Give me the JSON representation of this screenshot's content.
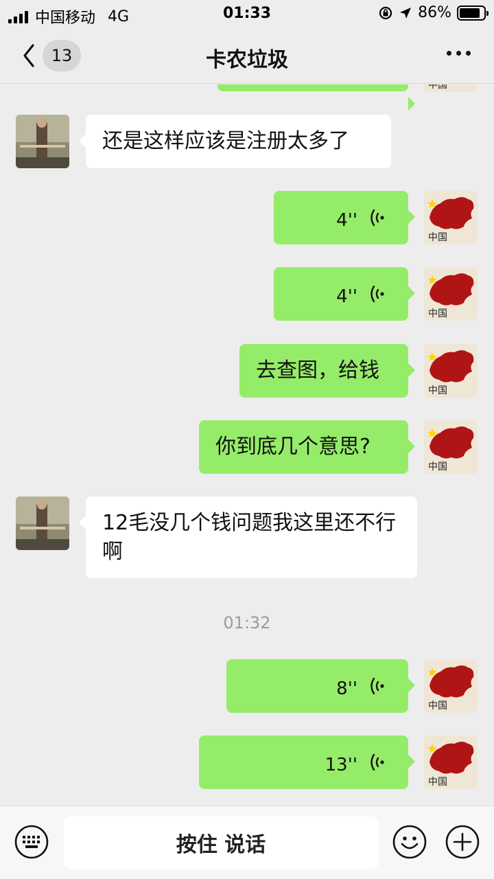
{
  "status_bar": {
    "carrier": "中国移动",
    "network": "4G",
    "time": "01:33",
    "battery": "86%",
    "battery_level": 0.86
  },
  "nav": {
    "unread_count": "13",
    "title": "卡农垃圾"
  },
  "messages": [
    {
      "side": "right",
      "type": "partial-voice"
    },
    {
      "side": "left",
      "type": "text",
      "text": "还是这样应该是注册太多了"
    },
    {
      "side": "right",
      "type": "voice",
      "duration": "4''"
    },
    {
      "side": "right",
      "type": "voice",
      "duration": "4''"
    },
    {
      "side": "right",
      "type": "text",
      "text": "去查图，给钱"
    },
    {
      "side": "right",
      "type": "text",
      "text": "你到底几个意思?"
    },
    {
      "side": "left",
      "type": "text",
      "text": "12毛没几个钱问题我这里还不行啊"
    },
    {
      "type": "timestamp",
      "text": "01:32"
    },
    {
      "side": "right",
      "type": "voice",
      "duration": "8''"
    },
    {
      "side": "right",
      "type": "voice",
      "duration": "13''"
    }
  ],
  "input_bar": {
    "hold_to_talk": "按住 说话"
  },
  "avatar_text": "中国",
  "colors": {
    "bubble_self": "#95ec69",
    "bubble_other": "#ffffff",
    "background": "#ededed"
  }
}
